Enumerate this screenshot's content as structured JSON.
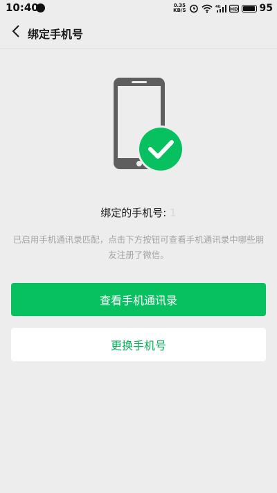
{
  "status_bar": {
    "time": "10:40",
    "net_speed_value": "0.35",
    "net_speed_unit": "KB/S",
    "network_type": "4G",
    "hd_label": "HD",
    "battery_level": "95"
  },
  "nav": {
    "title": "绑定手机号"
  },
  "bound_phone": {
    "label": "绑定的手机号:",
    "value": "1"
  },
  "description": "已启用手机通讯录匹配，点击下方按钮可查看手机通讯录中哪些朋友注册了微信。",
  "buttons": {
    "view_contacts": "查看手机通讯录",
    "change_phone": "更换手机号"
  },
  "colors": {
    "primary": "#07c160",
    "secondary_text": "#06ae56",
    "background": "#ededed"
  }
}
